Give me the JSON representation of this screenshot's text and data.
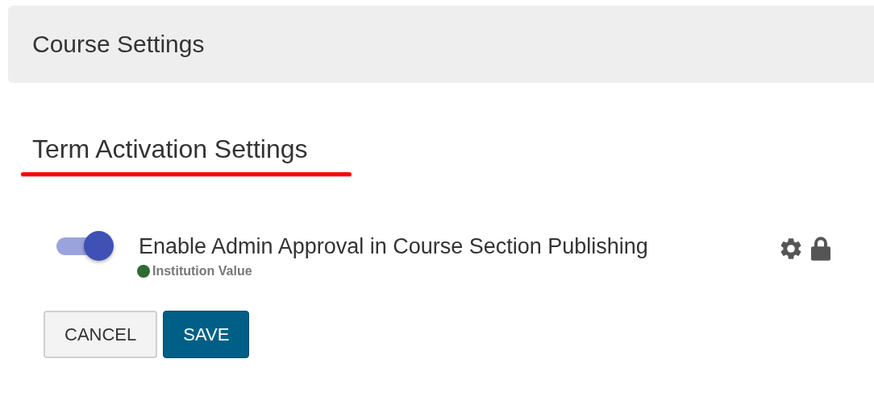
{
  "header": {
    "title": "Course Settings"
  },
  "section": {
    "title": "Term Activation Settings",
    "underlined": true
  },
  "settings": [
    {
      "label": "Enable Admin Approval in Course Section Publishing",
      "on": true,
      "source": {
        "label": "Institution Value",
        "color": "#2e6b34"
      },
      "locked": true
    }
  ],
  "buttons": [
    {
      "label": "CANCEL",
      "kind": "secondary"
    },
    {
      "label": "SAVE",
      "kind": "primary"
    }
  ]
}
